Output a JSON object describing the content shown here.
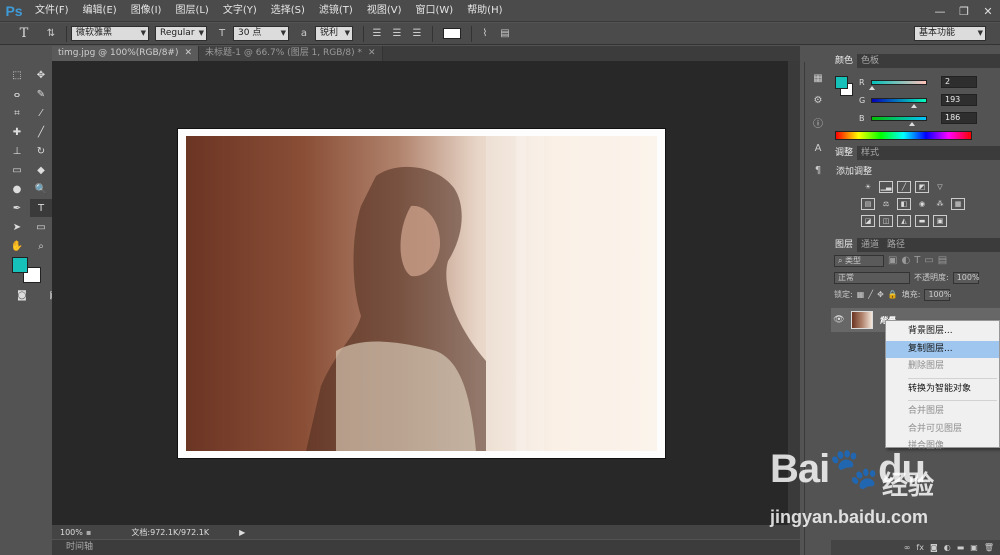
{
  "app": {
    "logo": "Ps"
  },
  "menu": {
    "items": [
      "文件(F)",
      "编辑(E)",
      "图像(I)",
      "图层(L)",
      "文字(Y)",
      "选择(S)",
      "滤镜(T)",
      "视图(V)",
      "窗口(W)",
      "帮助(H)"
    ]
  },
  "window_controls": {
    "minimize": "—",
    "restore": "❐",
    "close": "✕"
  },
  "options_bar": {
    "tool_icon": "T",
    "font_family": "微软雅黑",
    "font_style": "Regular",
    "font_size": "30 点",
    "anti_alias_label": "a",
    "anti_alias": "锐利",
    "text_color": "#ffffff",
    "workspace": "基本功能"
  },
  "tabs": [
    {
      "label": "timg.jpg @ 100%(RGB/8#)",
      "close": "✕",
      "active": true
    },
    {
      "label": "未标题-1 @ 66.7% (图层 1, RGB/8) *",
      "close": "✕",
      "active": false
    }
  ],
  "tools": [
    "marquee-icon",
    "move-icon",
    "lasso-icon",
    "quick-select-icon",
    "crop-icon",
    "eyedropper-icon",
    "healing-icon",
    "brush-icon",
    "stamp-icon",
    "history-brush-icon",
    "eraser-icon",
    "bucket-icon",
    "blur-icon",
    "dodge-icon",
    "pen-icon",
    "type-icon",
    "path-select-icon",
    "shape-icon",
    "hand-icon",
    "zoom-icon"
  ],
  "tool_glyphs": [
    "⬚",
    "✥",
    "ⴰ",
    "✎",
    "⌗",
    "⁄",
    "✚",
    "╱",
    "⊥",
    "↻",
    "▭",
    "◆",
    "●",
    "🔍",
    "✒",
    "T",
    "➤",
    "▭",
    "✋",
    "⌕"
  ],
  "foreground_color": "#16c1b9",
  "background_color": "#ffffff",
  "statusbar": {
    "zoom": "100%",
    "doc": "文档:972.1K/972.1K"
  },
  "timeline": {
    "label": "时间轴"
  },
  "color_panel": {
    "tabs": [
      "颜色",
      "色板"
    ],
    "r": {
      "label": "R",
      "value": "2"
    },
    "g": {
      "label": "G",
      "value": "193"
    },
    "b": {
      "label": "B",
      "value": "186"
    }
  },
  "adjustments_panel": {
    "tabs": [
      "调整",
      "样式"
    ],
    "title": "添加调整"
  },
  "layers_panel": {
    "tabs": [
      "图层",
      "通道",
      "路径"
    ],
    "filter_kind": "类型",
    "blend_mode": "正常",
    "opacity_label": "不透明度:",
    "opacity": "100%",
    "lock_label": "锁定:",
    "fill_label": "填充:",
    "fill": "100%",
    "layer_name": "背景"
  },
  "context_menu": {
    "items": [
      {
        "label": "背景图层...",
        "enabled": true
      },
      {
        "label": "复制图层...",
        "enabled": true,
        "highlighted": true
      },
      {
        "label": "删除图层",
        "enabled": false
      },
      {
        "label": "转换为智能对象",
        "enabled": true
      },
      {
        "label": "合并图层",
        "enabled": false
      },
      {
        "label": "合并可见图层",
        "enabled": false
      },
      {
        "label": "拼合图像",
        "enabled": false
      }
    ]
  },
  "watermark": {
    "logo": "Bai",
    "logo_suffix": "du",
    "cn": "经验",
    "url": "jingyan.baidu.com"
  }
}
